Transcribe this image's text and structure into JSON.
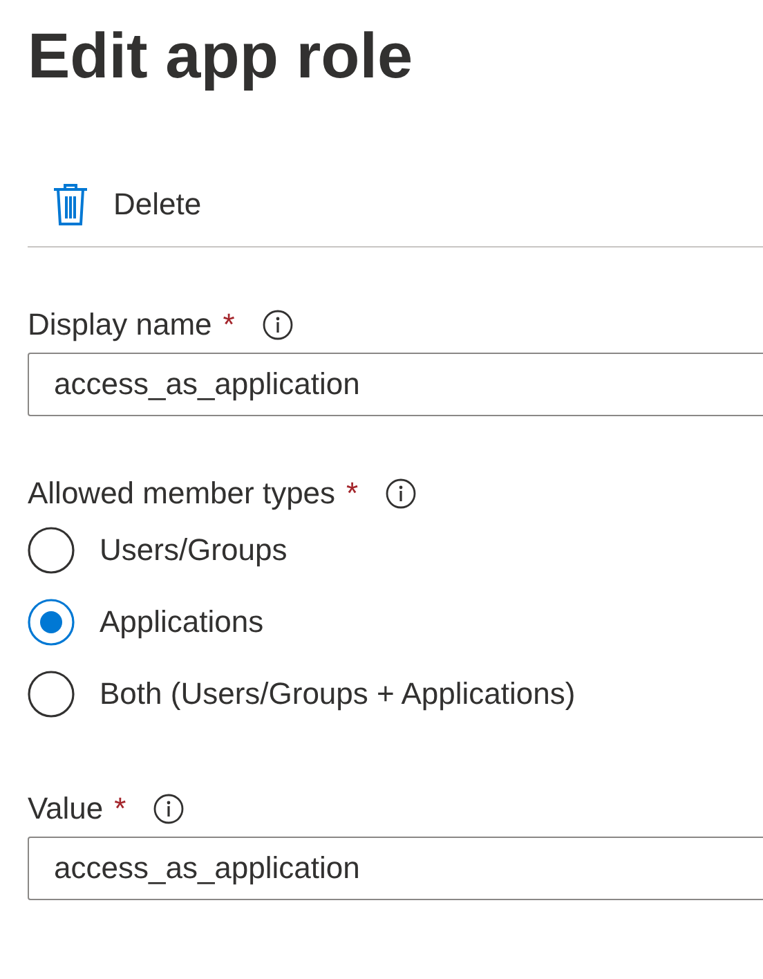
{
  "title": "Edit app role",
  "toolbar": [
    {
      "label": "Delete"
    }
  ],
  "fields": [
    {
      "kind": "text",
      "label": "Display name",
      "required_mark": "*",
      "value": "access_as_application"
    },
    {
      "kind": "radio",
      "label": "Allowed member types",
      "required_mark": "*",
      "options": [
        {
          "label": "Users/Groups",
          "selected": false
        },
        {
          "label": "Applications",
          "selected": true
        },
        {
          "label": "Both (Users/Groups + Applications)",
          "selected": false
        }
      ]
    },
    {
      "kind": "text",
      "label": "Value",
      "required_mark": "*",
      "value": "access_as_application"
    }
  ]
}
